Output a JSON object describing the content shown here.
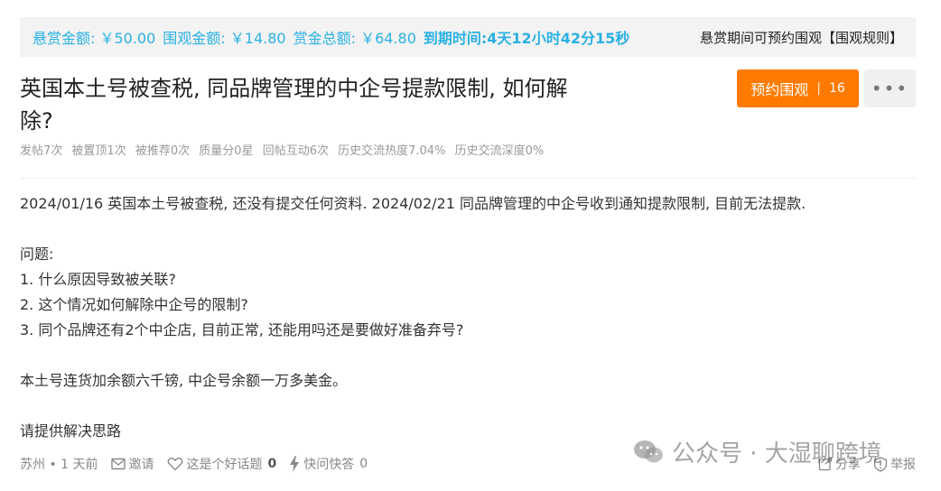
{
  "bounty": {
    "amount": "悬赏金额: ￥50.00",
    "watch_amount": "围观金额: ￥14.80",
    "total": "赏金总额: ￥64.80",
    "deadline": "到期时间:4天12小时42分15秒",
    "hint": "悬赏期间可预约围观",
    "rules_link": "【围观规则】",
    "accent_color": "#2ab0e3"
  },
  "question": {
    "title": "英国本土号被查税, 同品牌管理的中企号提款限制, 如何解除?",
    "reserve_label": "预约围观",
    "reserve_count": "16",
    "more_label": "•••",
    "stats": [
      "发帖7次",
      "被置顶1次",
      "被推荐0次",
      "质量分0星",
      "回帖互动6次",
      "历史交流热度7.04%",
      "历史交流深度0%"
    ],
    "body": {
      "line1": "2024/01/16 英国本土号被查税,  还没有提交任何资料. 2024/02/21 同品牌管理的中企号收到通知提款限制, 目前无法提款.",
      "q_header": "问题:",
      "q1": "1. 什么原因导致被关联?",
      "q2": "2. 这个情况如何解除中企号的限制?",
      "q3": "3. 同个品牌还有2个中企店, 目前正常, 还能用吗还是要做好准备弃号?",
      "balance": "本土号连货加余额六千镑, 中企号余额一万多美金。",
      "request": "请提供解决思路"
    }
  },
  "footer": {
    "location": "苏州 • 1 天前",
    "invite": "邀请",
    "good_topic": "这是个好话题",
    "good_topic_count": "0",
    "quick_answer": "快问快答",
    "quick_answer_count": "0",
    "share": "分享",
    "report": "举报"
  },
  "watermark": {
    "text": "公众号 · 大湿聊跨境"
  },
  "colors": {
    "reserve_button": "#ff7a00",
    "stats_text": "#999999"
  }
}
